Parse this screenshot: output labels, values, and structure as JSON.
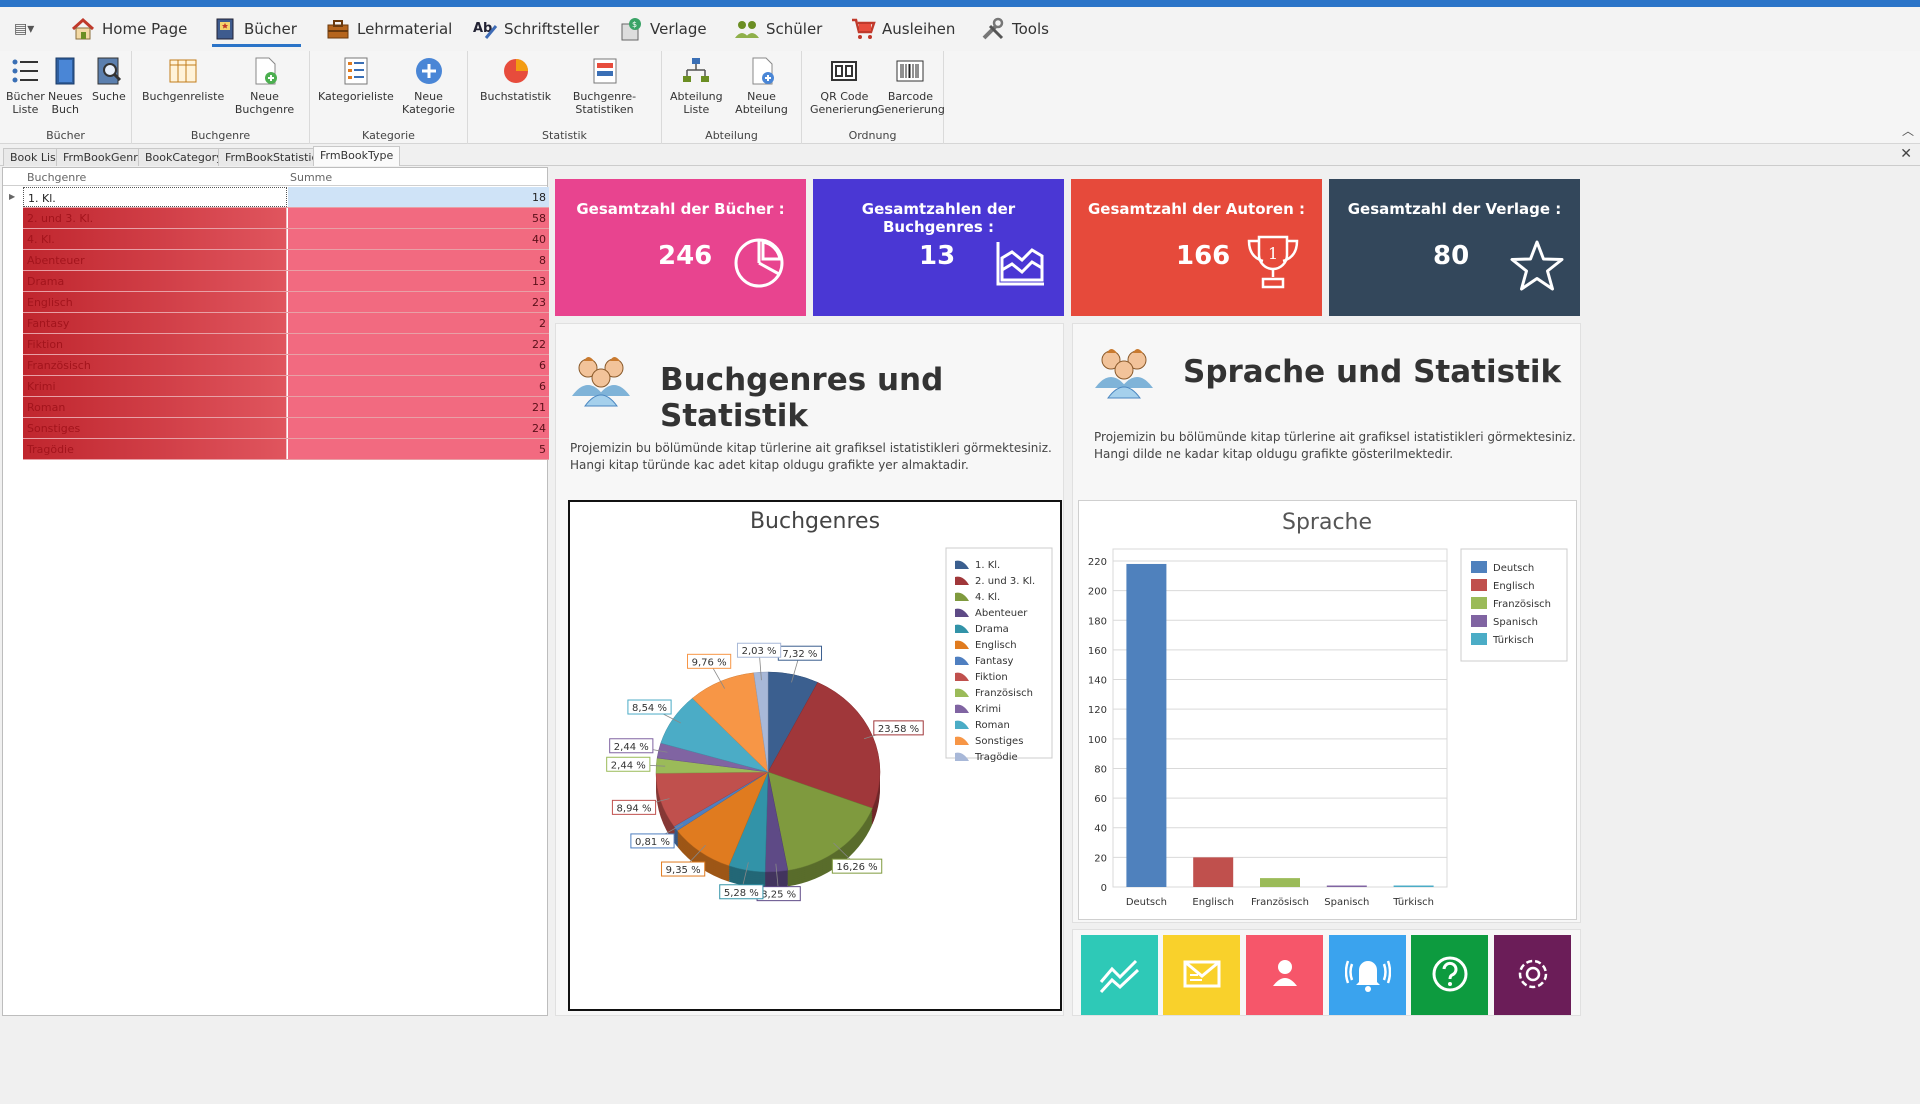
{
  "menu": {
    "tabs": [
      {
        "label": "Home Page",
        "icon": "house-icon"
      },
      {
        "label": "Bücher",
        "icon": "book-icon",
        "active": true
      },
      {
        "label": "Lehrmaterial",
        "icon": "briefcase-icon"
      },
      {
        "label": "Schriftsteller",
        "icon": "writer-icon"
      },
      {
        "label": "Verlage",
        "icon": "publisher-icon"
      },
      {
        "label": "Schüler",
        "icon": "students-icon"
      },
      {
        "label": "Ausleihen",
        "icon": "cart-icon"
      },
      {
        "label": "Tools",
        "icon": "tools-icon"
      }
    ]
  },
  "ribbon": {
    "groups": [
      {
        "label": "Bücher",
        "buttons": [
          {
            "label": "Bücher\nListe"
          },
          {
            "label": "Neues\nBuch"
          },
          {
            "label": "Suche"
          }
        ]
      },
      {
        "label": "Buchgenre",
        "buttons": [
          {
            "label": "Buchgenreliste"
          },
          {
            "label": "Neue Buchgenre"
          }
        ]
      },
      {
        "label": "Kategorie",
        "buttons": [
          {
            "label": "Kategorieliste"
          },
          {
            "label": "Neue Kategorie"
          }
        ]
      },
      {
        "label": "Statistik",
        "buttons": [
          {
            "label": "Buchstatistik"
          },
          {
            "label": "Buchgenre-Statistiken"
          }
        ]
      },
      {
        "label": "Abteilung",
        "buttons": [
          {
            "label": "Abteilung\nListe"
          },
          {
            "label": "Neue Abteilung"
          }
        ]
      },
      {
        "label": "Ordnung",
        "buttons": [
          {
            "label": "QR Code\nGenerierung"
          },
          {
            "label": "Barcode\nGenerierung"
          }
        ]
      }
    ]
  },
  "doc_tabs": [
    "Book List",
    "FrmBookGenre",
    "BookCategory",
    "FrmBookStatistics",
    "FrmBookType"
  ],
  "grid": {
    "headers": [
      "Buchgenre",
      "Summe"
    ],
    "rows": [
      {
        "name": "1. Kl.",
        "sum": "18"
      },
      {
        "name": "2. und 3. Kl.",
        "sum": "58"
      },
      {
        "name": "4. Kl.",
        "sum": "40"
      },
      {
        "name": "Abenteuer",
        "sum": "8"
      },
      {
        "name": "Drama",
        "sum": "13"
      },
      {
        "name": "Englisch",
        "sum": "23"
      },
      {
        "name": "Fantasy",
        "sum": "2"
      },
      {
        "name": "Fiktion",
        "sum": "22"
      },
      {
        "name": "Französisch",
        "sum": "6"
      },
      {
        "name": "Krimi",
        "sum": "6"
      },
      {
        "name": "Roman",
        "sum": "21"
      },
      {
        "name": "Sonstiges",
        "sum": "24"
      },
      {
        "name": "Tragödie",
        "sum": "5"
      }
    ]
  },
  "cards": [
    {
      "title": "Gesamtzahl der Bücher :",
      "value": "246",
      "color": "#e8448f",
      "icon": "pie-chart-icon"
    },
    {
      "title": "Gesamtzahlen der Buchgenres :",
      "value": "13",
      "color": "#4a37d4",
      "icon": "area-chart-icon"
    },
    {
      "title": "Gesamtzahl der Autoren :",
      "value": "166",
      "color": "#e64a3b",
      "icon": "trophy-icon"
    },
    {
      "title": "Gesamtzahl der Verlage :",
      "value": "80",
      "color": "#33475b",
      "icon": "star-icon"
    }
  ],
  "genre_panel": {
    "title": "Buchgenres und Statistik",
    "desc1": "Projemizin bu bölümünde kitap türlerine ait grafiksel istatistikleri görmektesiniz.",
    "desc2": "Hangi kitap türünde kac adet kitap oldugu grafikte yer almaktadir."
  },
  "lang_panel": {
    "title": "Sprache und Statistik",
    "desc1": "Projemizin bu bölümünde kitap türlerine ait grafiksel istatistikleri görmektesiniz.",
    "desc2": "Hangi dilde ne kadar kitap oldugu grafikte gösterilmektedir."
  },
  "chart_data": [
    {
      "type": "pie",
      "title": "Buchgenres",
      "legend_position": "right",
      "slices": [
        {
          "label": "1. Kl.",
          "value": 7.32,
          "display": "7,32 %",
          "color": "#3b5f8f"
        },
        {
          "label": "2. und 3. Kl.",
          "value": 23.58,
          "display": "23,58 %",
          "color": "#a0373a"
        },
        {
          "label": "4. Kl.",
          "value": 16.26,
          "display": "16,26 %",
          "color": "#7f9a3e"
        },
        {
          "label": "Abenteuer",
          "value": 3.25,
          "display": "3,25 %",
          "color": "#5e4a86"
        },
        {
          "label": "Drama",
          "value": 5.28,
          "display": "5,28 %",
          "color": "#3293a8"
        },
        {
          "label": "Englisch",
          "value": 9.35,
          "display": "9,35 %",
          "color": "#e07b1f"
        },
        {
          "label": "Fantasy",
          "value": 0.81,
          "display": "0,81 %",
          "color": "#4f7fc0"
        },
        {
          "label": "Fiktion",
          "value": 8.94,
          "display": "8,94 %",
          "color": "#c0504d"
        },
        {
          "label": "Französisch",
          "value": 2.44,
          "display": "2,44 %",
          "color": "#9bbb59"
        },
        {
          "label": "Krimi",
          "value": 2.44,
          "display": "2,44 %",
          "color": "#8064a2"
        },
        {
          "label": "Roman",
          "value": 8.54,
          "display": "8,54 %",
          "color": "#4bacc6"
        },
        {
          "label": "Sonstiges",
          "value": 9.76,
          "display": "9,76 %",
          "color": "#f79646"
        },
        {
          "label": "Tragödie",
          "value": 2.03,
          "display": "2,03 %",
          "color": "#a8b8d8"
        }
      ]
    },
    {
      "type": "bar",
      "title": "Sprache",
      "categories": [
        "Deutsch",
        "Englisch",
        "Französisch",
        "Spanisch",
        "Türkisch"
      ],
      "values": [
        218,
        20,
        6,
        1,
        1
      ],
      "colors": [
        "#4f81bd",
        "#c0504d",
        "#9bbb59",
        "#8064a2",
        "#4bacc6"
      ],
      "ylim": [
        0,
        220
      ],
      "yticks": [
        0,
        20,
        40,
        60,
        80,
        100,
        120,
        140,
        160,
        180,
        200,
        220
      ],
      "grid": true,
      "legend_position": "right"
    }
  ],
  "tiles": [
    {
      "icon": "trend-icon",
      "color": "#2ec9b7"
    },
    {
      "icon": "mail-icon",
      "color": "#f9d12b"
    },
    {
      "icon": "user-icon",
      "color": "#f6566a"
    },
    {
      "icon": "bell-icon",
      "color": "#3aa3ee"
    },
    {
      "icon": "help-icon",
      "color": "#0d9b3f"
    },
    {
      "icon": "settings-icon",
      "color": "#6b1d58"
    }
  ]
}
